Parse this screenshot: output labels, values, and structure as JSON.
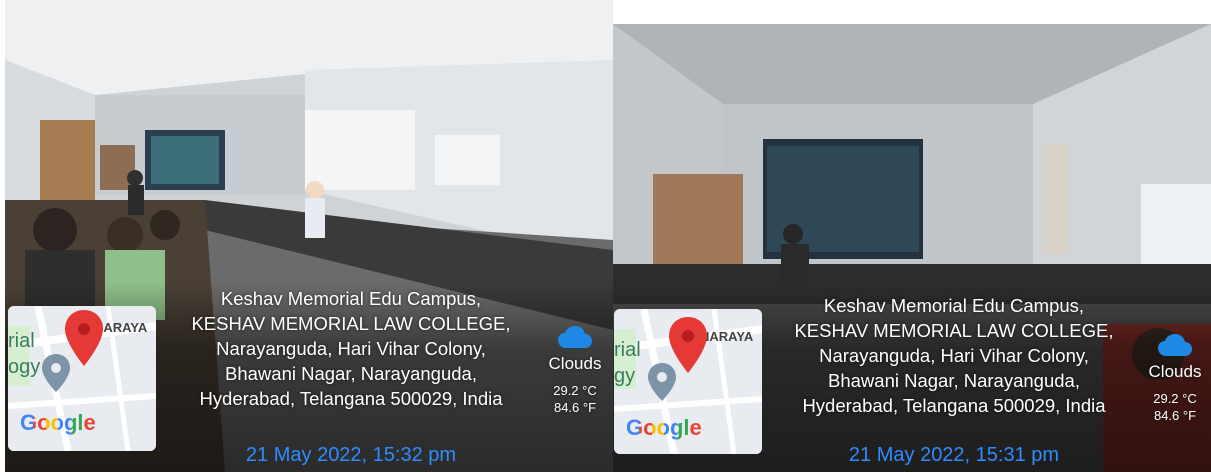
{
  "photos": [
    {
      "address_lines": [
        "Keshav Memorial Edu Campus,",
        "KESHAV MEMORIAL LAW COLLEGE,",
        "Narayanguda, Hari Vihar Colony,",
        "Bhawani Nagar, Narayanguda,",
        "Hyderabad, Telangana 500029, India"
      ],
      "datetime": "21 May 2022, 15:32 pm",
      "map": {
        "place_label": "NARAYA",
        "fragment_1": "rial",
        "fragment_2": "ogy",
        "brand": "Google"
      },
      "weather": {
        "condition": "Clouds",
        "temp_c": "29.2 °C",
        "temp_f": "84.6 °F",
        "icon": "cloud-icon"
      }
    },
    {
      "address_lines": [
        "Keshav Memorial Edu Campus,",
        "KESHAV MEMORIAL LAW COLLEGE,",
        "Narayanguda, Hari Vihar Colony,",
        "Bhawani Nagar, Narayanguda,",
        "Hyderabad, Telangana 500029, India"
      ],
      "datetime": "21 May 2022, 15:31 pm",
      "map": {
        "place_label": "NARAYA",
        "fragment_1": "rial",
        "fragment_2": "gy",
        "brand": "Google"
      },
      "weather": {
        "condition": "Clouds",
        "temp_c": "29.2 °C",
        "temp_f": "84.6 °F",
        "icon": "cloud-icon"
      }
    }
  ],
  "colors": {
    "datetime": "#2f8cff",
    "pin": "#e53935",
    "cloud": "#1e88e5"
  }
}
